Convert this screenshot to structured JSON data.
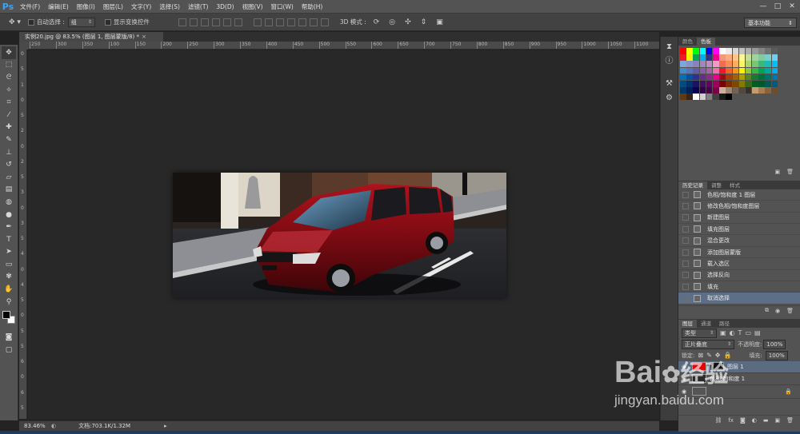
{
  "app": {
    "logo": "Ps"
  },
  "menu": [
    "文件(F)",
    "编辑(E)",
    "图像(I)",
    "图层(L)",
    "文字(Y)",
    "选择(S)",
    "滤镜(T)",
    "3D(D)",
    "视图(V)",
    "窗口(W)",
    "帮助(H)"
  ],
  "window_controls": {
    "minimize": "—",
    "restore": "□",
    "close": "✕"
  },
  "options": {
    "auto_select_label": "自动选择 :",
    "auto_select_value": "组",
    "show_transform_label": "显示变换控件",
    "mode_3d_label": "3D 模式 :",
    "workspace": "基本功能"
  },
  "document": {
    "tab_title": "实例20.jpg @ 83.5% (图层 1, 图层蒙版/8) *",
    "tab_close": "×"
  },
  "ruler_h": [
    "250",
    "300",
    "350",
    "100",
    "150",
    "200",
    "250",
    "300",
    "350",
    "400",
    "450",
    "500",
    "550",
    "600",
    "650",
    "700",
    "750",
    "800",
    "850",
    "900",
    "950",
    "1000",
    "1050",
    "1100"
  ],
  "ruler_v": [
    "0",
    "5",
    "1",
    "0",
    "5",
    "2",
    "0",
    "2",
    "5",
    "3",
    "0",
    "3",
    "5",
    "4",
    "0",
    "4",
    "5",
    "0",
    "5",
    "5",
    "6",
    "0",
    "6",
    "5"
  ],
  "status": {
    "zoom": "83.46%",
    "doc_info": "文档:703.1K/1.32M"
  },
  "panels": {
    "color_tabs": [
      "颜色",
      "色板"
    ],
    "history_tabs": [
      "历史记录",
      "调整",
      "样式"
    ],
    "history_items": [
      "色相/饱和度 1 图层",
      "修改色相/饱和度图层",
      "新建图层",
      "填充图层",
      "混合更改",
      "添加图层蒙版",
      "载入选区",
      "选择反向",
      "填充",
      "取消选择"
    ],
    "layers_tabs": [
      "图层",
      "通道",
      "路径"
    ],
    "filter_kind": "类型",
    "blend_mode": "正片叠底",
    "opacity_label": "不透明度:",
    "opacity_value": "100%",
    "lock_label": "锁定:",
    "fill_label": "填充:",
    "fill_value": "100%",
    "layers": [
      {
        "name": "图层 1",
        "selected": true
      },
      {
        "name": "色相/饱和度 1",
        "selected": false
      },
      {
        "name": "",
        "selected": false
      }
    ]
  },
  "watermark": {
    "brand": "Bai",
    "brand2": "经验",
    "url": "jingyan.baidu.com"
  },
  "colors": {
    "accent": "#3fa4f0",
    "selected_row": "#5d6f86",
    "layer_red": "#e60000"
  }
}
